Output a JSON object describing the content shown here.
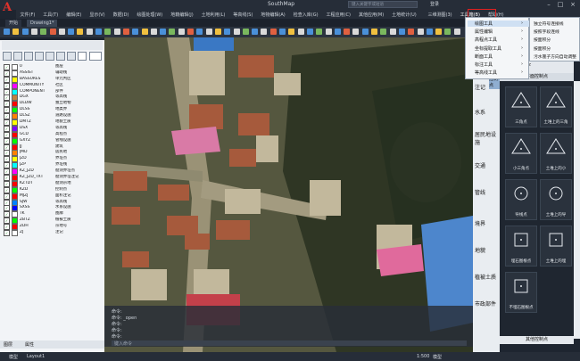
{
  "app": {
    "title": "SouthMap",
    "logo": "A"
  },
  "menu": [
    "文件(F)",
    "工具(T)",
    "编辑(E)",
    "显示(V)",
    "数据(D)",
    "绘图处理(W)",
    "地籍编辑(J)",
    "土地利用(L)",
    "等高线(S)",
    "地物编辑(A)",
    "检查入库(G)",
    "工程应用(C)",
    "其他应用(M)",
    "土地统计(U)",
    "检查入库(K)",
    "三维测图(3)",
    "图幅(B)",
    "成果管理(P)",
    "其他(O)"
  ],
  "header": {
    "search_placeholder": "键入关键字或短语",
    "login": "登录",
    "tool_menu": "工具箱(B)",
    "tool_menu2": "帮助(H)"
  },
  "tabs": [
    "开始",
    "Drawing1*"
  ],
  "dropdown": {
    "items": [
      "绘图工具",
      "属性编辑",
      "高程点工具",
      "坐标提取工具",
      "断面工具",
      "标注工具",
      "等高线工具"
    ],
    "submenu": [
      "独立符号连接线",
      "按照字段连线",
      "按面积分",
      "按面积分",
      "污水篦子方向自动调整"
    ]
  },
  "layer_panel": {
    "rows": [
      {
        "name": "0",
        "desc": "图层",
        "color": "#ffffff"
      },
      {
        "name": "ASSIST",
        "desc": "辅助线",
        "color": "#ffffff"
      },
      {
        "name": "BASSURES",
        "desc": "单元判区",
        "color": "#ffff00"
      },
      {
        "name": "COMMUNITY",
        "desc": "社区",
        "color": "#ff00ff"
      },
      {
        "name": "COMPONENT",
        "desc": "部件",
        "color": "#00ffff"
      },
      {
        "name": "DGX",
        "desc": "等高线",
        "color": "#c08040"
      },
      {
        "name": "DLDW",
        "desc": "独立地物",
        "color": "#ff0000"
      },
      {
        "name": "DLSS",
        "desc": "地类界",
        "color": "#00ff00"
      },
      {
        "name": "DLSZ",
        "desc": "道路设施",
        "color": "#ff8000"
      },
      {
        "name": "DMTZ",
        "desc": "地貌土质",
        "color": "#ffff00"
      },
      {
        "name": "DSX",
        "desc": "等高线",
        "color": "#8000ff"
      },
      {
        "name": "GCD",
        "desc": "高程点",
        "color": "#ff0000"
      },
      {
        "name": "GXYZ",
        "desc": "管线设施",
        "color": "#00ff00"
      },
      {
        "name": "JJ",
        "desc": "建筑",
        "color": "#ff0000"
      },
      {
        "name": "JMD",
        "desc": "居民地",
        "color": "#ff8000"
      },
      {
        "name": "JZD",
        "desc": "界址点",
        "color": "#ffff00"
      },
      {
        "name": "JZP",
        "desc": "界址线",
        "color": "#00ffff"
      },
      {
        "name": "KZ_JZD",
        "desc": "勘测界址点",
        "color": "#ff00ff"
      },
      {
        "name": "KZ_JZD_TXT",
        "desc": "勘测界址注记",
        "color": "#ff0000"
      },
      {
        "name": "KZTDT",
        "desc": "勘测宗地",
        "color": "#ff0000"
      },
      {
        "name": "KZD",
        "desc": "控制点",
        "color": "#00ff00"
      },
      {
        "name": "MJZJ",
        "desc": "面积注记",
        "color": "#ff0000"
      },
      {
        "name": "SJW",
        "desc": "等高线",
        "color": "#0080ff"
      },
      {
        "name": "SXSS",
        "desc": "水系设施",
        "color": "#0000ff"
      },
      {
        "name": "TK",
        "desc": "图廓",
        "color": "#ffffff"
      },
      {
        "name": "ZBTZ",
        "desc": "植被土质",
        "color": "#00ff00"
      },
      {
        "name": "ZDH",
        "desc": "宗地号",
        "color": "#ff0000"
      },
      {
        "name": "ZJ",
        "desc": "注记",
        "color": "#ffffff"
      }
    ],
    "tabs": [
      "图层",
      "属性"
    ]
  },
  "command": {
    "lines": [
      "命令:",
      "命令: _open",
      "命令:",
      "命令:",
      "命令:"
    ],
    "prompt": "键入命令"
  },
  "right_strip": [
    "注记",
    "水系",
    "居民地设施",
    "交通",
    "管线",
    "境界",
    "地貌",
    "植被土质",
    "市政部件"
  ],
  "right_panel": {
    "header": "平面控制点",
    "header2": "文字",
    "header3": "控制点",
    "symbols": [
      "三角点",
      "土堆上的三角",
      "小三角点",
      "土堆上的小",
      "导线点",
      "土堆上的导",
      "埋石图根点",
      "土堆上的埋",
      "不埋石图根点"
    ],
    "footer": "其他控制点"
  },
  "status": {
    "tabs": [
      "模型",
      "Layout1"
    ],
    "scale": "1:500",
    "zoom": "模型"
  }
}
